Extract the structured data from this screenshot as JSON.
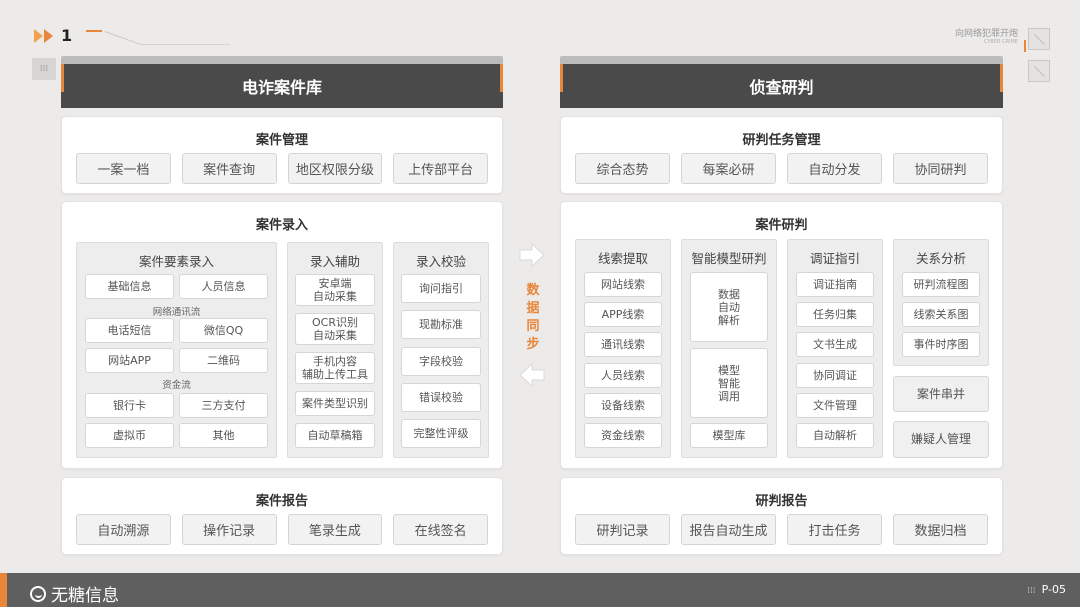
{
  "header": {
    "page_number": "1",
    "top_right_main": "向网络犯罪开炮",
    "top_right_sub": "CYBER CRIME"
  },
  "left": {
    "title": "电诈案件库",
    "case_management": {
      "title": "案件管理",
      "buttons": [
        "一案一档",
        "案件查询",
        "地区权限分级",
        "上传部平台"
      ]
    },
    "case_entry": {
      "title": "案件录入",
      "elements": {
        "title": "案件要素录入",
        "row1": [
          "基础信息",
          "人员信息"
        ],
        "label_network": "网络通讯流",
        "row2": [
          "电话短信",
          "微信QQ"
        ],
        "row3": [
          "网站APP",
          "二维码"
        ],
        "label_funds": "资金流",
        "row4": [
          "银行卡",
          "三方支付"
        ],
        "row5": [
          "虚拟币",
          "其他"
        ]
      },
      "assist": {
        "title": "录入辅助",
        "items": [
          "安卓端\n自动采集",
          "OCR识别\n自动采集",
          "手机内容\n辅助上传工具",
          "案件类型识别",
          "自动草稿箱"
        ]
      },
      "verify": {
        "title": "录入校验",
        "items": [
          "询问指引",
          "现勘标准",
          "字段校验",
          "错误校验",
          "完整性评级"
        ]
      }
    },
    "case_report": {
      "title": "案件报告",
      "buttons": [
        "自动溯源",
        "操作记录",
        "笔录生成",
        "在线签名"
      ]
    }
  },
  "sync": {
    "text": "数据同步"
  },
  "right": {
    "title": "侦查研判",
    "task_management": {
      "title": "研判任务管理",
      "buttons": [
        "综合态势",
        "每案必研",
        "自动分发",
        "协同研判"
      ]
    },
    "case_analysis": {
      "title": "案件研判",
      "clues": {
        "title": "线索提取",
        "items": [
          "网站线索",
          "APP线索",
          "通讯线索",
          "人员线索",
          "设备线索",
          "资金线索"
        ]
      },
      "ai_model": {
        "title": "智能模型研判",
        "items": [
          "数据\n自动\n解析",
          "模型\n智能\n调用",
          "模型库"
        ]
      },
      "evidence": {
        "title": "调证指引",
        "items": [
          "调证指南",
          "任务归集",
          "文书生成",
          "协同调证",
          "文件管理",
          "自动解析"
        ]
      },
      "relations": {
        "title": "关系分析",
        "items": [
          "研判流程图",
          "线索关系图",
          "事件时序图"
        ]
      },
      "merge": "案件串并",
      "suspect": "嫌疑人管理"
    },
    "report": {
      "title": "研判报告",
      "buttons": [
        "研判记录",
        "报告自动生成",
        "打击任务",
        "数据归档"
      ]
    }
  },
  "footer": {
    "brand": "无糖信息",
    "page": "P-05"
  },
  "colors": {
    "accent": "#e8863a",
    "header_bg": "#4a4a4a",
    "footer_bg": "#5f5f5f"
  }
}
